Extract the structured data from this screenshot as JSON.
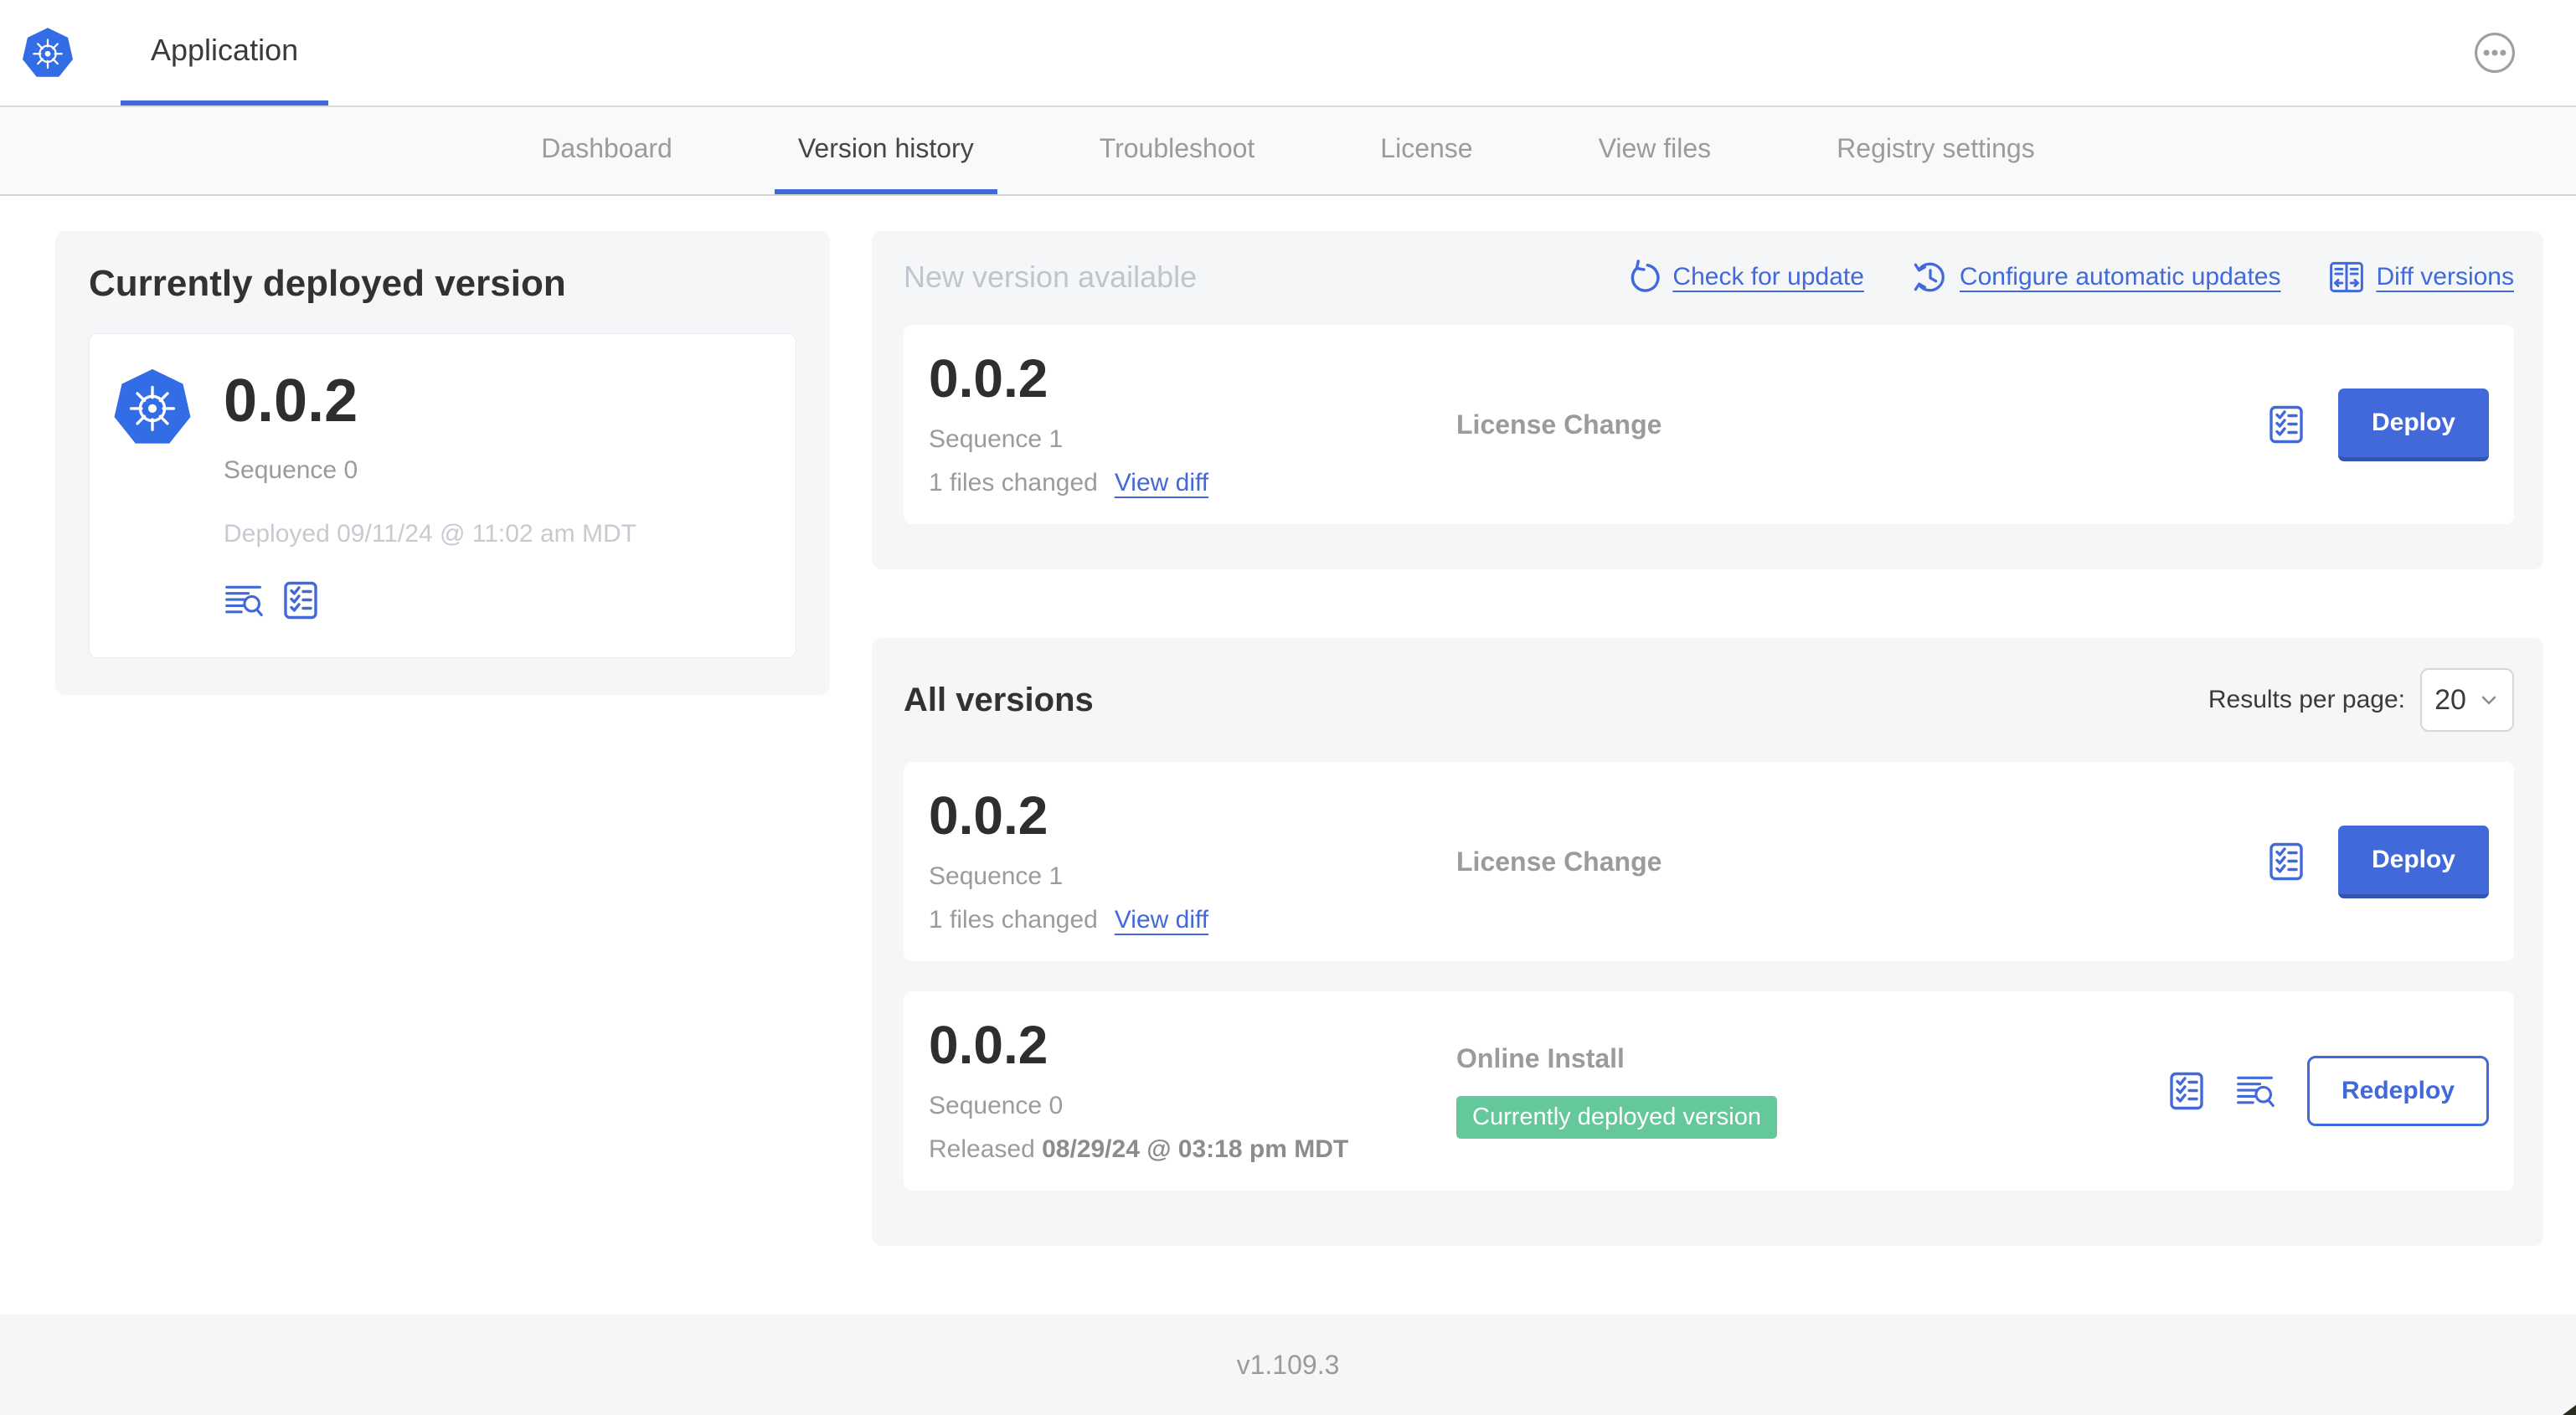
{
  "header": {
    "app_tab_label": "Application",
    "logo_icon": "kubernetes-icon",
    "menu_icon": "ellipsis-icon"
  },
  "nav": {
    "tabs": [
      {
        "label": "Dashboard",
        "active": false
      },
      {
        "label": "Version history",
        "active": true
      },
      {
        "label": "Troubleshoot",
        "active": false
      },
      {
        "label": "License",
        "active": false
      },
      {
        "label": "View files",
        "active": false
      },
      {
        "label": "Registry settings",
        "active": false
      }
    ]
  },
  "current": {
    "title": "Currently deployed version",
    "version": "0.0.2",
    "sequence": "Sequence 0",
    "deployed": "Deployed 09/11/24 @ 11:02 am MDT",
    "icons": [
      "logs-icon",
      "checklist-icon"
    ]
  },
  "new_version": {
    "title": "New version available",
    "actions": [
      {
        "label": "Check for update",
        "icon": "refresh-icon"
      },
      {
        "label": "Configure automatic updates",
        "icon": "clock-refresh-icon"
      },
      {
        "label": "Diff versions",
        "icon": "diff-icon"
      }
    ],
    "row": {
      "version": "0.0.2",
      "sequence": "Sequence 1",
      "files_changed": "1 files changed",
      "view_diff_label": "View diff",
      "source": "License Change",
      "deploy_label": "Deploy"
    }
  },
  "all_versions": {
    "title": "All versions",
    "results_per_page_label": "Results per page:",
    "results_per_page_value": "20",
    "rows": [
      {
        "version": "0.0.2",
        "sequence": "Sequence 1",
        "files_changed": "1 files changed",
        "view_diff_label": "View diff",
        "source": "License Change",
        "action_label": "Deploy"
      },
      {
        "version": "0.0.2",
        "sequence": "Sequence 0",
        "released_prefix": "Released",
        "released_date": "08/29/24 @ 03:18 pm MDT",
        "source": "Online Install",
        "badge": "Currently deployed version",
        "action_label": "Redeploy"
      }
    ]
  },
  "footer": {
    "version": "v1.109.3"
  },
  "colors": {
    "accent_blue": "#4169d9",
    "logo_blue": "#326de6",
    "badge_green": "#65c89b",
    "panel_gray": "#f5f6f8"
  }
}
